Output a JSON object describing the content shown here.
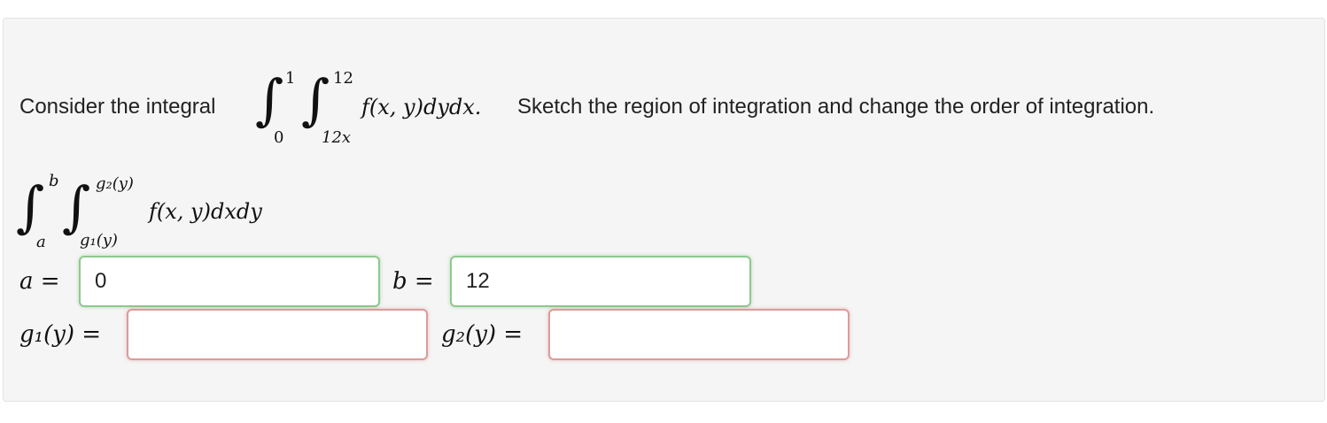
{
  "question": {
    "prefix": "Consider the integral",
    "outer_upper": "1",
    "outer_lower": "0",
    "inner_upper": "12",
    "inner_lower": "12x",
    "integrand": "f(x, y)dydx.",
    "suffix": "Sketch the region of integration and change the order of integration."
  },
  "reversed": {
    "outer_upper": "b",
    "outer_lower": "a",
    "inner_upper": "g₂(y)",
    "inner_lower": "g₁(y)",
    "integrand": "f(x, y)dxdy"
  },
  "fields": {
    "a_label": "a =",
    "a_value": "0",
    "b_label": "b =",
    "b_value": "12",
    "g1_label": "g₁(y) =",
    "g1_value": "",
    "g2_label": "g₂(y) =",
    "g2_value": ""
  },
  "colors": {
    "correct_border": "#8ec98e",
    "incorrect_border": "#dc9b9b",
    "panel_background": "#f5f5f5"
  }
}
